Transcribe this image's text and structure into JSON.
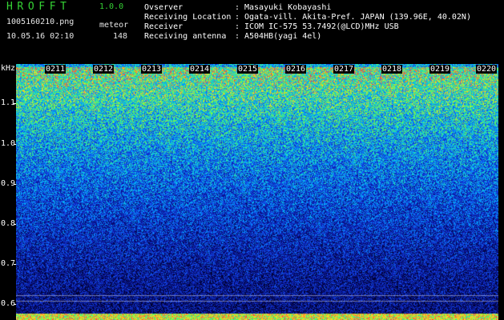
{
  "header": {
    "app_title": "HROFFT",
    "app_version": "1.0.0",
    "filename": "1005160210.png",
    "timestamp": "10.05.16 02:10",
    "meteor_label": "meteor",
    "meteor_count": "148"
  },
  "info": [
    {
      "label": "Ovserver",
      "value": "Masayuki Kobayashi"
    },
    {
      "label": "Receiving Location",
      "value": "Ogata-vill. Akita-Pref. JAPAN (139.96E, 40.02N)"
    },
    {
      "label": "Receiver",
      "value": "ICOM IC-575 53.7492(@LCD)MHz USB"
    },
    {
      "label": "Receiving antenna",
      "value": "A504HB(yagi 4el)"
    }
  ],
  "separator": ":",
  "plot": {
    "y_unit": "kHz",
    "y_ticks": [
      "1.1",
      "1.0",
      "0.9",
      "0.8",
      "0.7",
      "0.6"
    ],
    "y_range": [
      0.58,
      1.22
    ],
    "time_labels": [
      "0211",
      "0212",
      "0213",
      "0214",
      "0215",
      "0216",
      "0217",
      "0218",
      "0219",
      "0220"
    ]
  },
  "colors": {
    "app_title": "#35d335",
    "background": "#000000",
    "text": "#ffffff"
  }
}
